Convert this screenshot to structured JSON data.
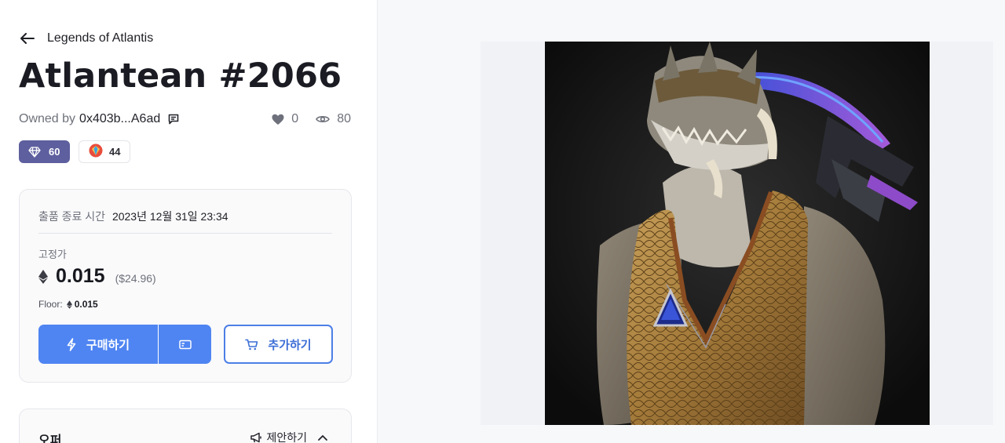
{
  "header": {
    "collection": "Legends of Atlantis",
    "title": "Atlantean #2066"
  },
  "owner": {
    "label": "Owned by",
    "address": "0x403b...A6ad"
  },
  "stats": {
    "likes": "0",
    "views": "80"
  },
  "badges": {
    "gem": "60",
    "rank": "44"
  },
  "listing": {
    "sale_end_label": "출품 종료 시간",
    "sale_end_value": "2023년 12월 31일 23:34",
    "fixed_price_label": "고정가",
    "price": "0.015",
    "usd": "($24.96)",
    "floor_label": "Floor:",
    "floor_value": "0.015",
    "buy_label": "구매하기",
    "add_label": "추가하기"
  },
  "offers": {
    "title": "오퍼",
    "propose_label": "제안하기"
  },
  "colors": {
    "primary": "#4f85f2",
    "gem_badge": "#5e5f9e"
  },
  "icons": [
    "arrow-left-icon",
    "chat-icon",
    "heart-icon",
    "eye-icon",
    "diamond-icon",
    "rank-icon",
    "eth-icon",
    "lightning-icon",
    "card-icon",
    "cart-icon",
    "megaphone-icon",
    "chevron-up-icon"
  ]
}
